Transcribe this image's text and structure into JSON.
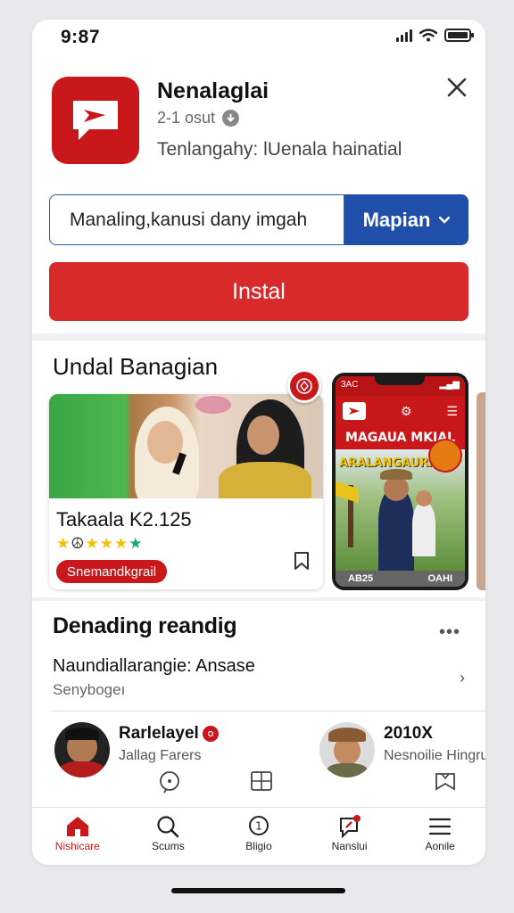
{
  "status": {
    "time": "9:87"
  },
  "app": {
    "name": "Nenalaglai",
    "meta": "2-1 osut",
    "description": "Tenlangahy: lUenala hainatial"
  },
  "search": {
    "value": "Manaling,kanusi dany imgah",
    "select_label": "Mapian"
  },
  "install_label": "Instal",
  "section1": {
    "title": "Undal Banagian",
    "card": {
      "title": "Takaala K2.125",
      "rating": 5,
      "badge": "Snemandkgrail"
    },
    "phone_preview": {
      "status_time": "3AC",
      "banner": "MAGAUA MKIAL",
      "overlay_text": "ARALANGAURAIS",
      "footer_left": "AB25",
      "footer_right": "OAHI"
    }
  },
  "section2": {
    "title": "Denading reandig",
    "item": {
      "title": "Naundiallarangie: Ansase",
      "subtitle": "Senybogeı"
    },
    "people": [
      {
        "name": "Rarlelayel",
        "sub": "Jallag Farers"
      },
      {
        "name": "2010X",
        "sub": "Nesnoilie Hingrus"
      }
    ]
  },
  "tabs": [
    {
      "label": "Nishicare",
      "icon": "home-icon",
      "active": true
    },
    {
      "label": "Scums",
      "icon": "search-icon"
    },
    {
      "label": "Bligio",
      "icon": "badge-icon"
    },
    {
      "label": "Nanslui",
      "icon": "pin-icon"
    },
    {
      "label": "Aonile",
      "icon": "menu-icon"
    }
  ],
  "colors": {
    "brand_red": "#c9181b",
    "install_red": "#d82a2b",
    "select_blue": "#1f4fa8"
  }
}
